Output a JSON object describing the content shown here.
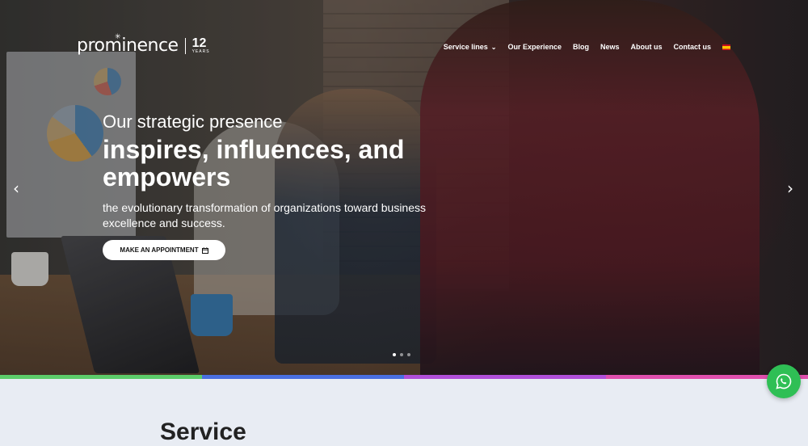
{
  "brand": {
    "name": "prominence",
    "anniversary_number": "12",
    "anniversary_unit": "YEARS"
  },
  "nav": {
    "items": [
      {
        "label": "Service lines",
        "has_dropdown": true
      },
      {
        "label": "Our Experience"
      },
      {
        "label": "Blog"
      },
      {
        "label": "News"
      },
      {
        "label": "About us"
      },
      {
        "label": "Contact us"
      }
    ],
    "language_flag": "es-flag-icon"
  },
  "hero": {
    "lead": "Our strategic presence",
    "headline_line1": "inspires, influences, and",
    "headline_line2": "empowers",
    "subtext": "the evolutionary transformation of organizations toward business excellence and success.",
    "cta_label": "MAKE AN APPOINTMENT",
    "cta_icon": "calendar-icon",
    "slides": {
      "total": 3,
      "active": 1
    }
  },
  "section": {
    "title": "Service"
  },
  "colors": {
    "stripe": [
      "#5ccc6a",
      "#4a6fe0",
      "#b14fd9",
      "#e04fae"
    ],
    "whatsapp": "#2fbf55"
  },
  "icons": {
    "prev": "chevron-left-icon",
    "next": "chevron-right-icon",
    "whatsapp": "whatsapp-icon"
  }
}
